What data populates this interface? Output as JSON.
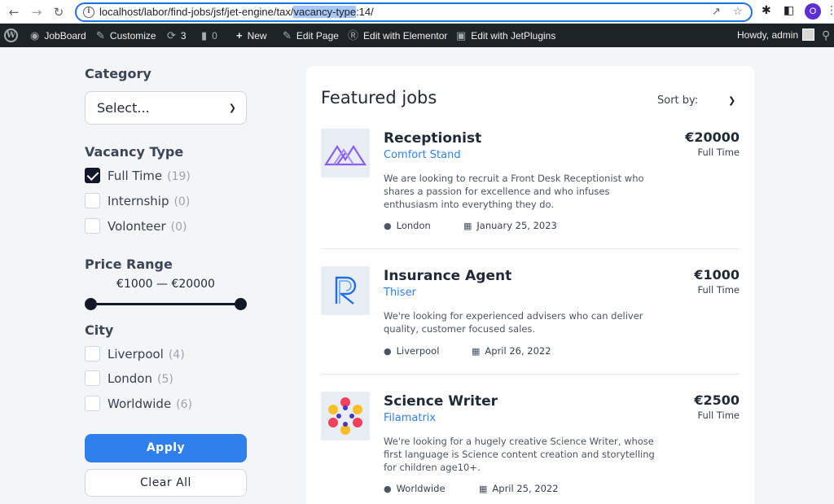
{
  "browser": {
    "url_prefix": "localhost/labor/find-jobs/jsf/jet-engine/tax/",
    "url_highlight": "vacancy-type",
    "url_suffix": ":14/",
    "profile_initial": "O"
  },
  "adminbar": {
    "jobboard": "JobBoard",
    "customize": "Customize",
    "updates_count": "3",
    "comments_count": "0",
    "new": "New",
    "edit_page": "Edit Page",
    "elementor": "Edit with Elementor",
    "jetplugins": "Edit with JetPlugins",
    "howdy": "Howdy, admin"
  },
  "filters": {
    "category_title": "Category",
    "category_select": "Select...",
    "vacancy_title": "Vacancy Type",
    "vacancy": [
      {
        "label": "Full Time",
        "count": "(19)",
        "checked": true
      },
      {
        "label": "Internship",
        "count": "(0)",
        "checked": false
      },
      {
        "label": "Volonteer",
        "count": "(0)",
        "checked": false
      }
    ],
    "price_title": "Price Range",
    "price_range": "€1000 — €20000",
    "city_title": "City",
    "city": [
      {
        "label": "Liverpool",
        "count": "(4)",
        "checked": false
      },
      {
        "label": "London",
        "count": "(5)",
        "checked": false
      },
      {
        "label": "Worldwide",
        "count": "(6)",
        "checked": false
      }
    ],
    "apply": "Apply",
    "clear": "Clear All"
  },
  "jobs_panel": {
    "title": "Featured jobs",
    "sort_label": "Sort by:",
    "jobs": [
      {
        "title": "Receptionist",
        "company": "Comfort Stand",
        "salary": "€20000",
        "type": "Full Time",
        "desc": "We are looking to recruit a Front Desk Receptionist who shares a passion for excellence and who infuses enthusiasm into everything they do.",
        "location": "London",
        "date": "January 25, 2023",
        "logo_color": "#8b5cf6"
      },
      {
        "title": "Insurance Agent",
        "company": "Thiser",
        "salary": "€1000",
        "type": "Full Time",
        "desc": "We're looking for experienced advisers who can deliver quality, customer focused sales.",
        "location": "Liverpool",
        "date": "April 26, 2022",
        "logo_color": "#1e6fe0"
      },
      {
        "title": "Science Writer",
        "company": "Filamatrix",
        "salary": "€2500",
        "type": "Full Time",
        "desc": "We're looking for a hugely creative Science Writer, whose first language is Science content creation and storytelling for children age10+.",
        "location": "Worldwide",
        "date": "April 25, 2022",
        "logo_color": "#f43f5e"
      }
    ]
  }
}
